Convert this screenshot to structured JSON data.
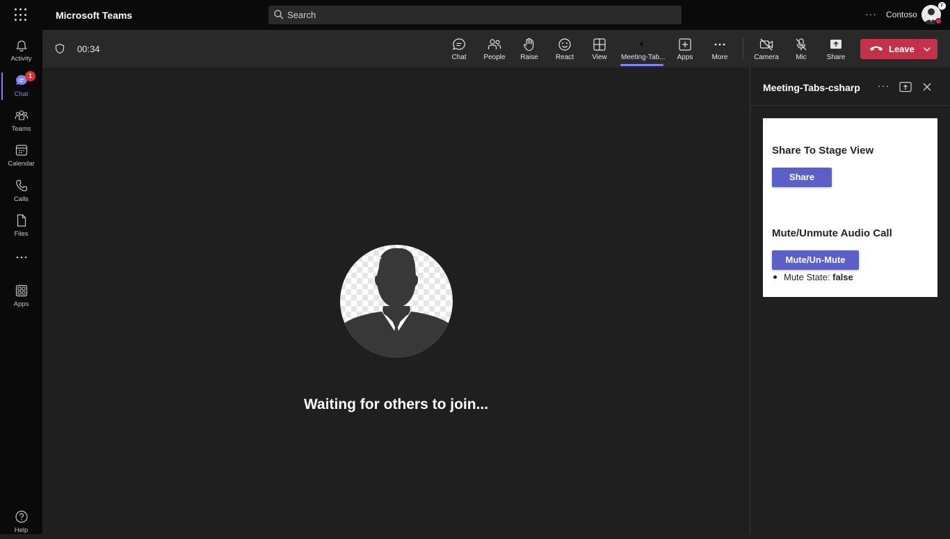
{
  "app": {
    "title": "Microsoft Teams",
    "search_placeholder": "Search",
    "org_name": "Contoso",
    "avatar_badge": "F"
  },
  "rail": {
    "items": [
      {
        "label": "Activity",
        "icon": "bell-icon"
      },
      {
        "label": "Chat",
        "icon": "chat-icon",
        "badge": "1",
        "active": true
      },
      {
        "label": "Teams",
        "icon": "teams-icon"
      },
      {
        "label": "Calendar",
        "icon": "calendar-icon"
      },
      {
        "label": "Calls",
        "icon": "phone-icon"
      },
      {
        "label": "Files",
        "icon": "file-icon"
      },
      {
        "label": "",
        "icon": "more-icon"
      },
      {
        "label": "Apps",
        "icon": "apps-icon"
      }
    ],
    "help_label": "Help"
  },
  "meeting": {
    "timer": "00:34",
    "controls": [
      {
        "label": "Chat",
        "icon": "chat-icon"
      },
      {
        "label": "People",
        "icon": "people-icon"
      },
      {
        "label": "Raise",
        "icon": "hand-icon"
      },
      {
        "label": "React",
        "icon": "smile-icon"
      },
      {
        "label": "View",
        "icon": "grid-icon"
      },
      {
        "label": "Meeting-Tab...",
        "icon": "tab-app-icon",
        "active": true
      },
      {
        "label": "Apps",
        "icon": "plus-icon"
      },
      {
        "label": "More",
        "icon": "more-icon"
      },
      {
        "label": "Camera",
        "icon": "camera-off-icon"
      },
      {
        "label": "Mic",
        "icon": "mic-off-icon"
      },
      {
        "label": "Share",
        "icon": "share-icon"
      }
    ],
    "leave_label": "Leave"
  },
  "stage": {
    "waiting_text": "Waiting for others to join..."
  },
  "panel": {
    "title": "Meeting-Tabs-csharp",
    "share_heading": "Share To Stage View",
    "share_button": "Share",
    "mute_heading": "Mute/Unmute Audio Call",
    "mute_button": "Mute/Un-Mute",
    "mute_state_label": "Mute State:",
    "mute_state_value": "false"
  },
  "colors": {
    "accent": "#7f85f5",
    "button": "#5b5fc7",
    "leave": "#c4314b"
  }
}
